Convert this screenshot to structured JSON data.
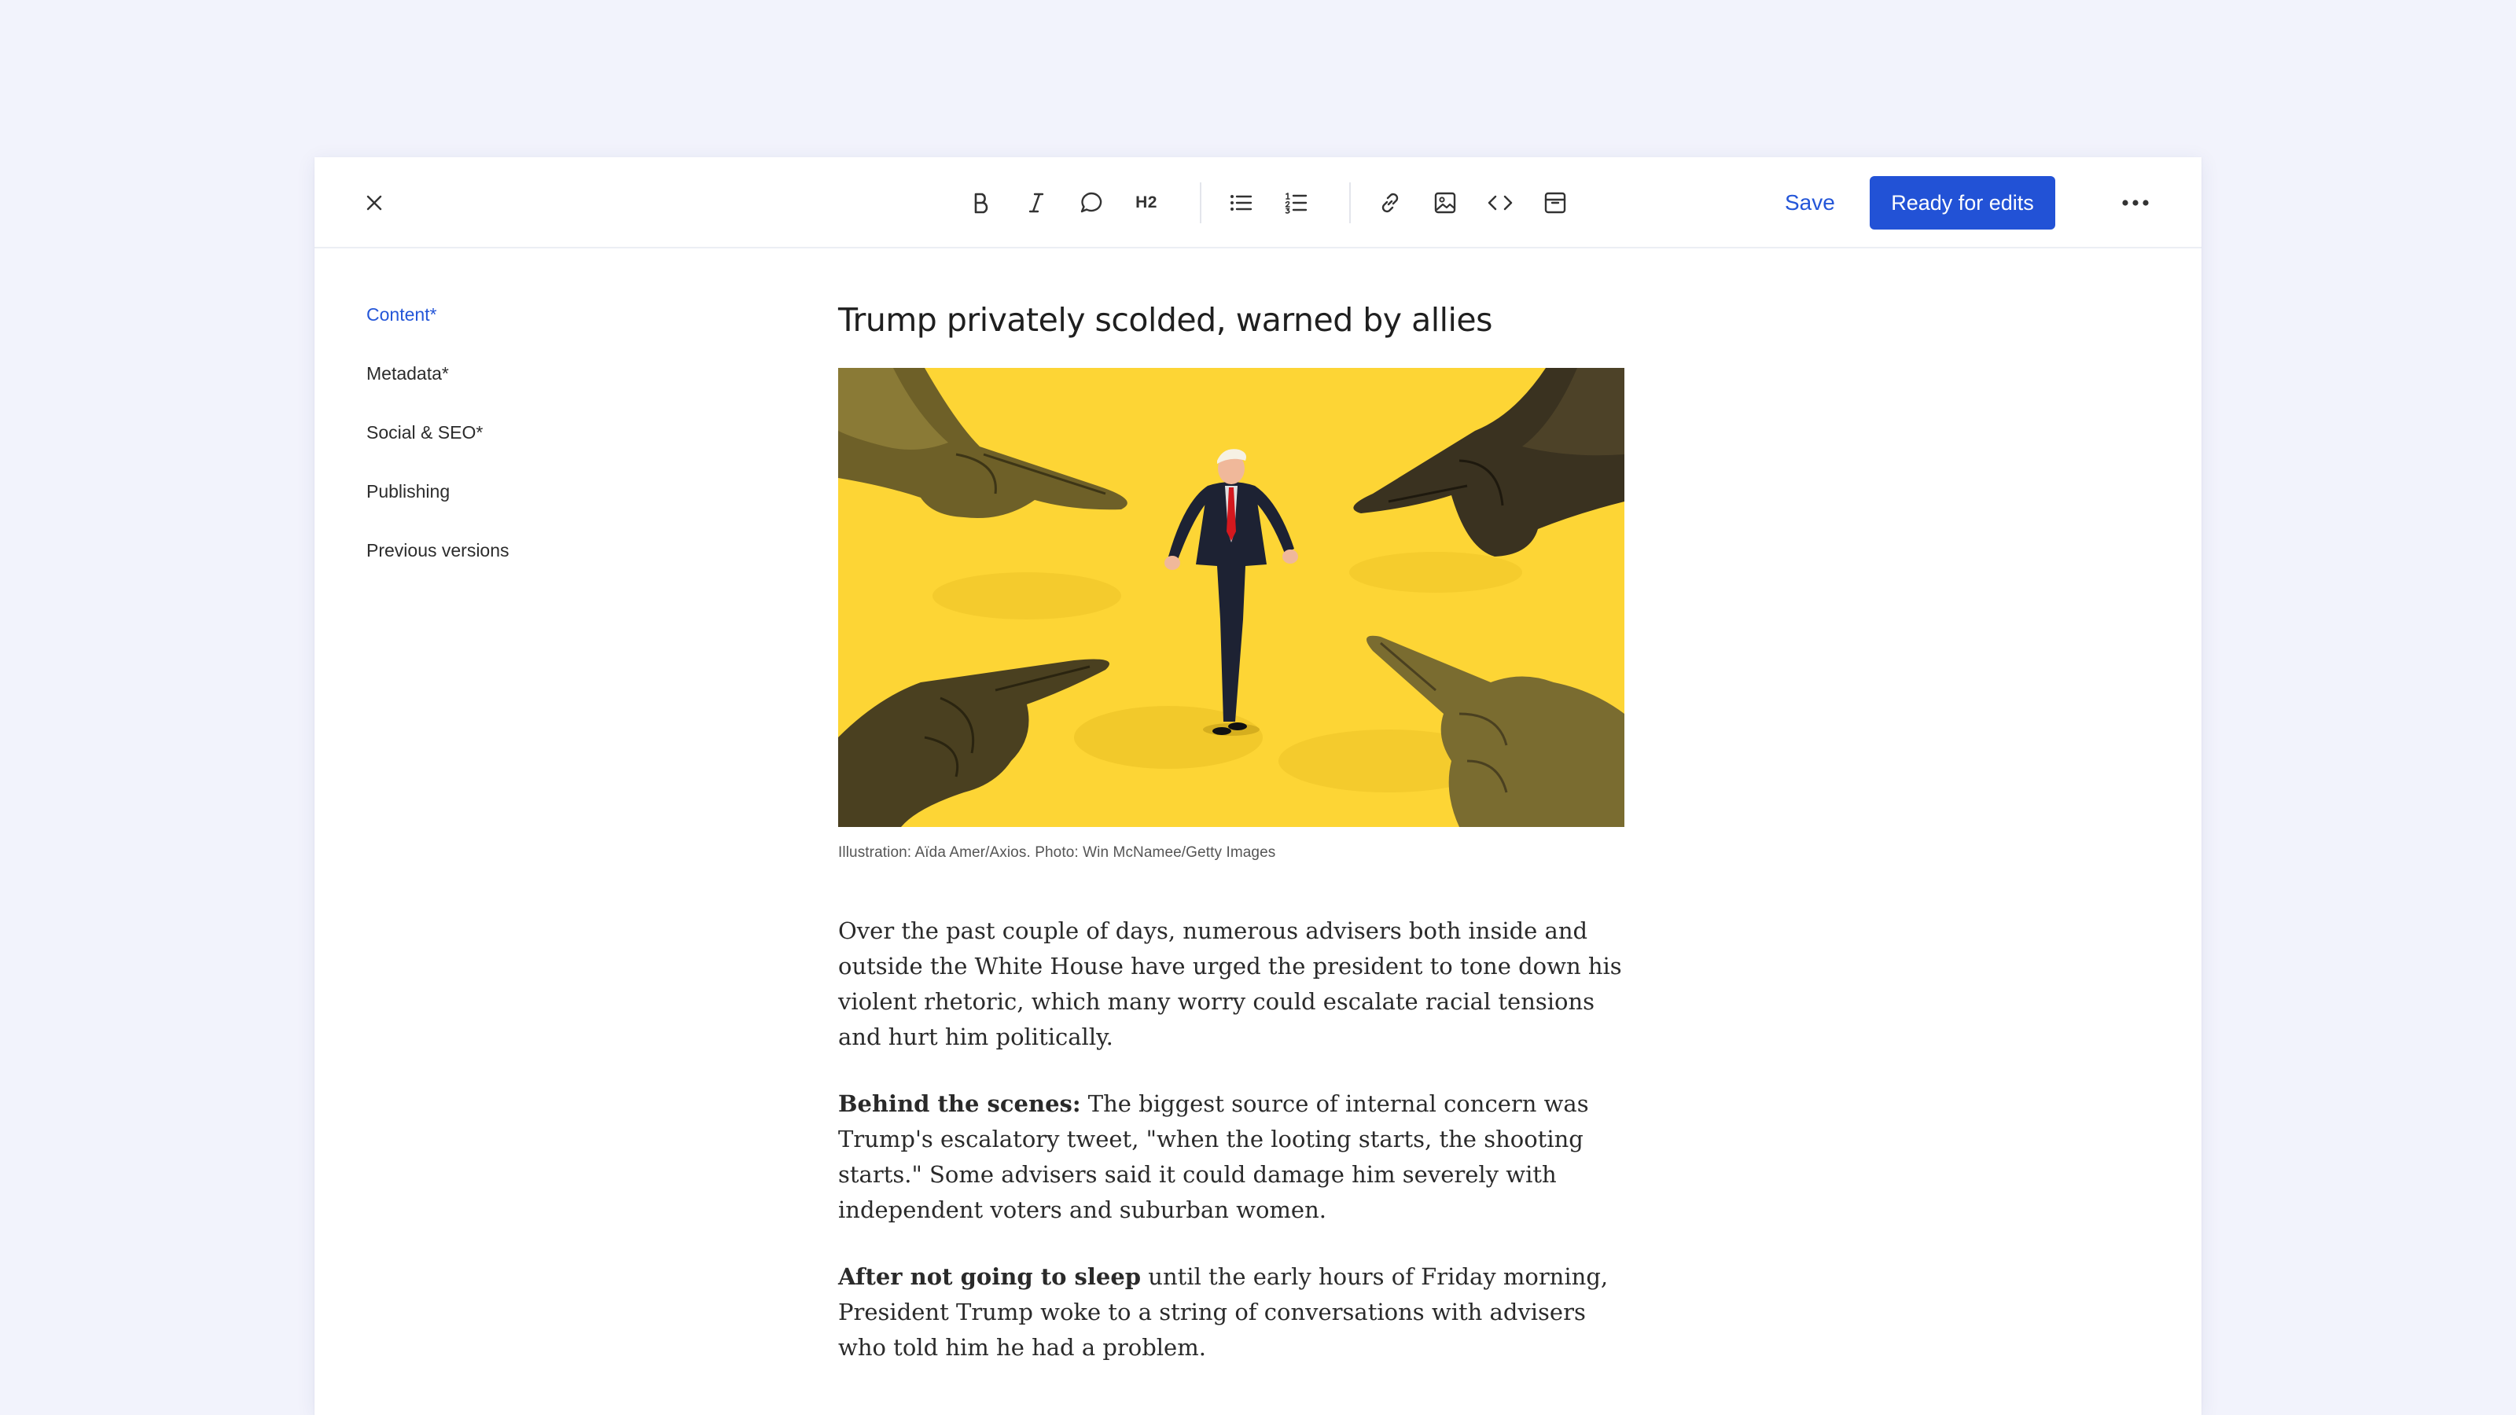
{
  "toolbar": {
    "save_label": "Save",
    "ready_label": "Ready for edits",
    "heading_label": "H2",
    "icons": [
      "close-icon",
      "bold-icon",
      "italic-icon",
      "comment-icon",
      "h2-icon",
      "bulleted-list-icon",
      "numbered-list-icon",
      "link-icon",
      "image-icon",
      "code-icon",
      "embed-icon",
      "more-icon"
    ]
  },
  "sidebar": {
    "items": [
      {
        "label": "Content*",
        "active": true
      },
      {
        "label": "Metadata*",
        "active": false
      },
      {
        "label": "Social & SEO*",
        "active": false
      },
      {
        "label": "Publishing",
        "active": false
      },
      {
        "label": "Previous versions",
        "active": false
      }
    ]
  },
  "article": {
    "headline": "Trump privately scolded, warned by allies",
    "caption": "Illustration: Aïda Amer/Axios. Photo: Win McNamee/Getty Images",
    "paragraphs": [
      {
        "lead": "",
        "text": "Over the past couple of days, numerous advisers both inside and outside the White House have urged the president to tone down his violent rhetoric, which many worry could escalate racial tensions and hurt him politically."
      },
      {
        "lead": "Behind the scenes:",
        "text": " The biggest source of internal concern was Trump's escalatory tweet, \"when the looting starts, the shooting starts.\" Some advisers said it could damage him severely with independent voters and suburban women."
      },
      {
        "lead": "After not going to sleep",
        "text": " until the early hours of Friday morning, President Trump woke to a string of conversations with advisers who told him he had a problem."
      }
    ]
  },
  "colors": {
    "accent": "#2252d6",
    "background": "#f2f3fc",
    "hero_background": "#fdd535"
  }
}
